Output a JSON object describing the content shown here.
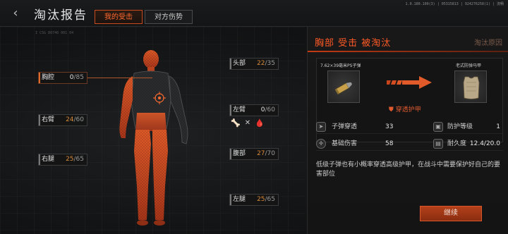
{
  "header": {
    "title": "淘汰报告",
    "tabs": [
      {
        "label": "我的受击",
        "active": true
      },
      {
        "label": "对方伤势",
        "active": false
      }
    ],
    "version": "1.0.180.100(3) | 05315813 | 924276258(1) | 流畅",
    "subcode": "I CSG 80740 001 04"
  },
  "body_parts": {
    "thorax": {
      "label": "胸腔",
      "current": "0",
      "max": "/85"
    },
    "right_arm": {
      "label": "右臂",
      "current": "24",
      "max": "/60"
    },
    "right_leg": {
      "label": "右腿",
      "current": "25",
      "max": "/65"
    },
    "head": {
      "label": "头部",
      "current": "22",
      "max": "/35"
    },
    "left_arm": {
      "label": "左臂",
      "current": "0",
      "max": "/60"
    },
    "stomach": {
      "label": "腹部",
      "current": "27",
      "max": "/70"
    },
    "left_leg": {
      "label": "左腿",
      "current": "25",
      "max": "/65"
    }
  },
  "status_icons": [
    "fracture-icon",
    "bleeding-icon"
  ],
  "panel": {
    "title": "胸部  受击  被淘汰",
    "reason": "淘汰原因",
    "ammo_name": "7.62×39毫米PS子弹",
    "armor_name": "老式防弹马甲",
    "penetration_label": "穿透护甲",
    "stats": [
      {
        "icon": "bullet-penetration-icon",
        "label": "子弹穿透",
        "value": "33"
      },
      {
        "icon": "armor-class-icon",
        "label": "防护等级",
        "value": "1"
      },
      {
        "icon": "crosshair-icon",
        "label": "基础伤害",
        "value": "58"
      },
      {
        "icon": "durability-icon",
        "label": "耐久度",
        "value": "12.4/20.0"
      }
    ],
    "description": "低级子弹也有小概率穿透高级护甲，在战斗中需要保护好自己的要害部位",
    "continue_label": "继续"
  },
  "colors": {
    "accent": "#ff5a26",
    "body_red": "#c8451c",
    "damage_value": "#d98a3a"
  }
}
